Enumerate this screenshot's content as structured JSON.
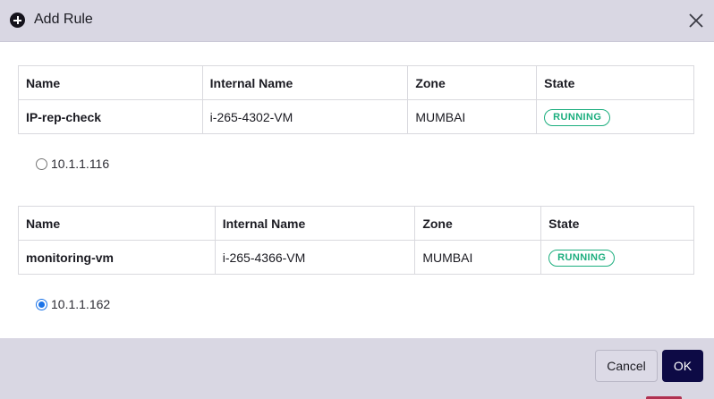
{
  "dialog": {
    "title": "Add Rule",
    "icon": "plus-circle-icon",
    "close_icon": "close-icon"
  },
  "tables": [
    {
      "columns": [
        "Name",
        "Internal Name",
        "Zone",
        "State"
      ],
      "row": {
        "name": "IP-rep-check",
        "internal_name": "i-265-4302-VM",
        "zone": "MUMBAI",
        "state": "RUNNING"
      },
      "ip": {
        "value": "10.1.1.116",
        "selected": false
      }
    },
    {
      "columns": [
        "Name",
        "Internal Name",
        "Zone",
        "State"
      ],
      "row": {
        "name": "monitoring-vm",
        "internal_name": "i-265-4366-VM",
        "zone": "MUMBAI",
        "state": "RUNNING"
      },
      "ip": {
        "value": "10.1.1.162",
        "selected": true
      }
    }
  ],
  "footer": {
    "cancel_label": "Cancel",
    "ok_label": "OK"
  },
  "colors": {
    "header_bg": "#d9d7e3",
    "ok_bg": "#0d0a45",
    "status_running": "#1cae7e",
    "radio_selected": "#1a73e8"
  }
}
